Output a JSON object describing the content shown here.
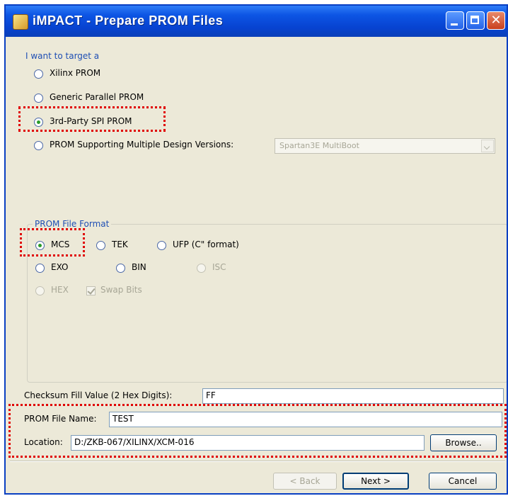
{
  "window": {
    "title": "iMPACT - Prepare PROM Files"
  },
  "target": {
    "heading": "I want to target a",
    "options": [
      "Xilinx PROM",
      "Generic Parallel PROM",
      "3rd-Party SPI PROM",
      "PROM Supporting Multiple Design Versions:"
    ],
    "selected": "3rd-Party SPI PROM",
    "multiboot_value": "Spartan3E MultiBoot"
  },
  "format": {
    "heading": "PROM File Format",
    "options": [
      "MCS",
      "TEK",
      "UFP (C\" format)",
      "EXO",
      "BIN",
      "ISC",
      "HEX"
    ],
    "selected": "MCS",
    "swap_bits_label": "Swap Bits"
  },
  "checksum": {
    "label": "Checksum Fill Value (2 Hex Digits):",
    "value": "FF"
  },
  "file_name": {
    "label": "PROM File Name:",
    "value": "TEST"
  },
  "location": {
    "label": "Location:",
    "value": "D:/ZKB-067/XILINX/XCM-016"
  },
  "buttons": {
    "browse": "Browse..",
    "back": "< Back",
    "next": "Next >",
    "cancel": "Cancel"
  },
  "colors": {
    "accent": "#1f4fb4",
    "highlight": "#e00000",
    "titlebar": "#0d55e4"
  }
}
